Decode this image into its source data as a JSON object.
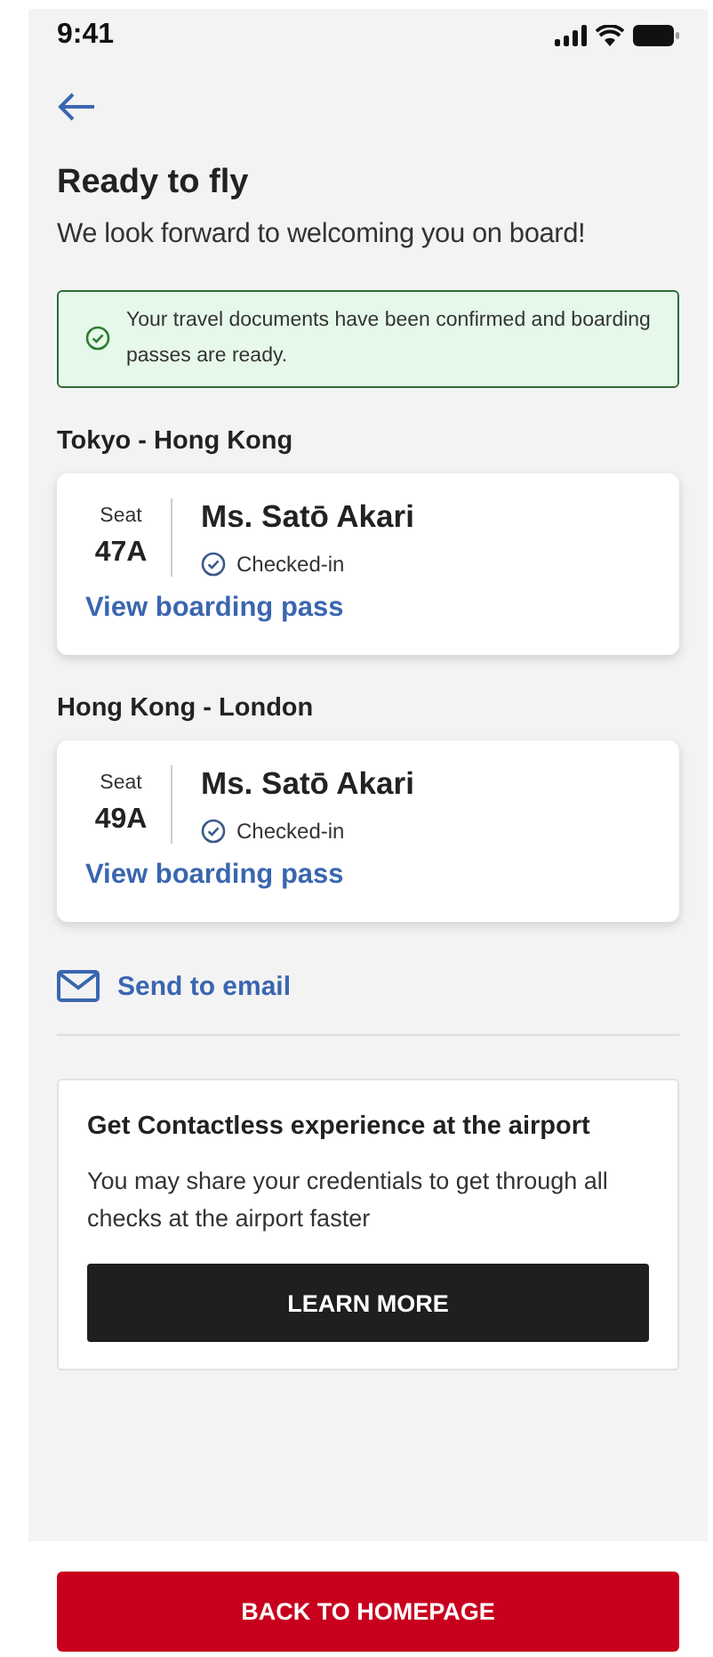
{
  "status_bar": {
    "time": "9:41"
  },
  "header": {
    "title": "Ready to fly",
    "subtitle": "We look forward to welcoming you on board!"
  },
  "notice": {
    "text": "Your travel documents have been confirmed and boarding passes are ready."
  },
  "flights": [
    {
      "route": "Tokyo - Hong Kong",
      "seat_label": "Seat",
      "seat": "47A",
      "passenger": "Ms. Satō Akari",
      "status": "Checked-in",
      "link": "View boarding pass"
    },
    {
      "route": "Hong Kong - London",
      "seat_label": "Seat",
      "seat": "49A",
      "passenger": "Ms. Satō Akari",
      "status": "Checked-in",
      "link": "View boarding pass"
    }
  ],
  "email_link": "Send to email",
  "promo": {
    "title": "Get Contactless experience at the airport",
    "text": "You may share your credentials to get through all checks at the airport faster",
    "button": "LEARN MORE"
  },
  "footer_button": "BACK TO HOMEPAGE"
}
